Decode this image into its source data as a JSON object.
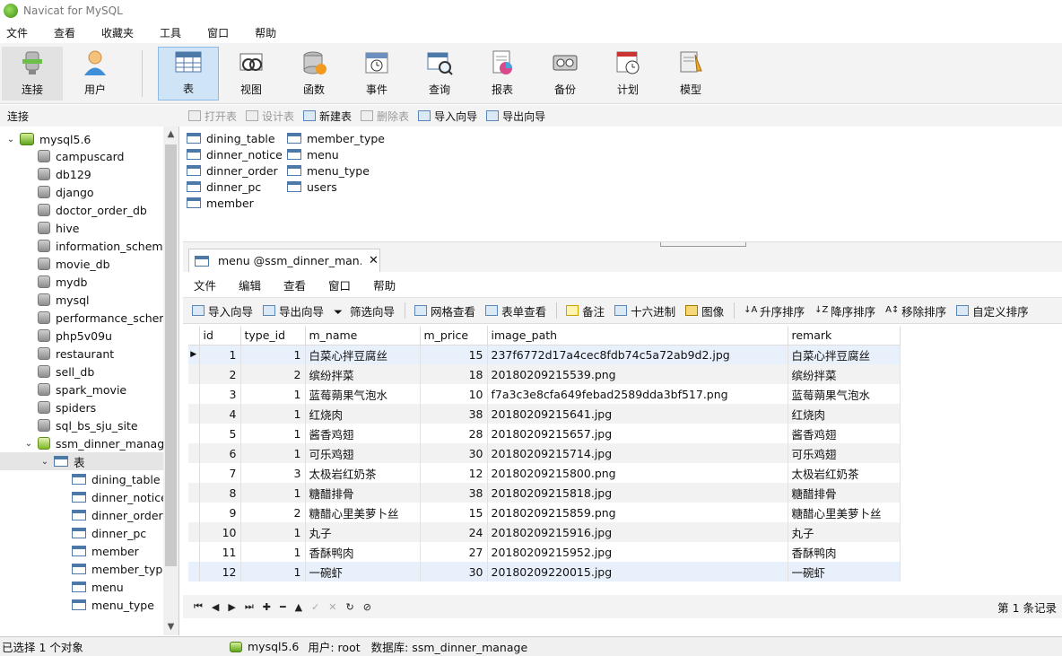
{
  "window": {
    "title": "Navicat for MySQL"
  },
  "menubar": [
    "文件",
    "查看",
    "收藏夹",
    "工具",
    "窗口",
    "帮助"
  ],
  "toolbar": [
    {
      "label": "连接",
      "icon": "connection-icon"
    },
    {
      "label": "用户",
      "icon": "user-icon"
    },
    {
      "label": "表",
      "icon": "table-icon",
      "active": true
    },
    {
      "label": "视图",
      "icon": "view-icon"
    },
    {
      "label": "函数",
      "icon": "function-icon"
    },
    {
      "label": "事件",
      "icon": "event-icon"
    },
    {
      "label": "查询",
      "icon": "query-icon"
    },
    {
      "label": "报表",
      "icon": "report-icon"
    },
    {
      "label": "备份",
      "icon": "backup-icon"
    },
    {
      "label": "计划",
      "icon": "schedule-icon"
    },
    {
      "label": "模型",
      "icon": "model-icon"
    }
  ],
  "conn_header": "连接",
  "object_toolbar": [
    {
      "label": "打开表",
      "enabled": false
    },
    {
      "label": "设计表",
      "enabled": false
    },
    {
      "label": "新建表",
      "enabled": true
    },
    {
      "label": "删除表",
      "enabled": false
    },
    {
      "label": "导入向导",
      "enabled": true
    },
    {
      "label": "导出向导",
      "enabled": true
    }
  ],
  "sidebar": {
    "connection": "mysql5.6",
    "databases": [
      "campuscard",
      "db129",
      "django",
      "doctor_order_db",
      "hive",
      "information_schema",
      "movie_db",
      "mydb",
      "mysql",
      "performance_schem",
      "php5v09u",
      "restaurant",
      "sell_db",
      "spark_movie",
      "spiders",
      "sql_bs_sju_site",
      "ssm_dinner_manage"
    ],
    "tables_node": "表",
    "tables": [
      "dining_table",
      "dinner_notice",
      "dinner_order",
      "dinner_pc",
      "member",
      "member_type",
      "menu",
      "menu_type"
    ]
  },
  "objects": {
    "col1": [
      "dining_table",
      "dinner_notice",
      "dinner_order",
      "dinner_pc",
      "member"
    ],
    "col2": [
      "member_type",
      "menu",
      "menu_type",
      "users"
    ]
  },
  "tab": {
    "label": "menu @ssm_dinner_man...",
    "close": "✕"
  },
  "sub_menubar": [
    "文件",
    "编辑",
    "查看",
    "窗口",
    "帮助"
  ],
  "grid_toolbar": [
    "导入向导",
    "导出向导",
    "筛选向导",
    "网格查看",
    "表单查看",
    "备注",
    "十六进制",
    "图像",
    "升序排序",
    "降序排序",
    "移除排序",
    "自定义排序"
  ],
  "grid": {
    "columns": [
      "id",
      "type_id",
      "m_name",
      "m_price",
      "image_path",
      "remark"
    ],
    "rows": [
      [
        "1",
        "1",
        "白菜心拌豆腐丝",
        "15",
        "237f6772d17a4cec8fdb74c5a72ab9d2.jpg",
        "白菜心拌豆腐丝"
      ],
      [
        "2",
        "2",
        "缤纷拌菜",
        "18",
        "20180209215539.png",
        "缤纷拌菜"
      ],
      [
        "3",
        "1",
        "蓝莓蒴果气泡水",
        "10",
        "f7a3c3e8cfa649febad2589dda3bf517.png",
        "蓝莓蒴果气泡水"
      ],
      [
        "4",
        "1",
        "红烧肉",
        "38",
        "20180209215641.jpg",
        "红烧肉"
      ],
      [
        "5",
        "1",
        "酱香鸡翅",
        "28",
        "20180209215657.jpg",
        "酱香鸡翅"
      ],
      [
        "6",
        "1",
        "可乐鸡翅",
        "30",
        "20180209215714.jpg",
        "可乐鸡翅"
      ],
      [
        "7",
        "3",
        "太极岩红奶茶",
        "12",
        "20180209215800.png",
        "太极岩红奶茶"
      ],
      [
        "8",
        "1",
        "糖醋排骨",
        "38",
        "20180209215818.jpg",
        "糖醋排骨"
      ],
      [
        "9",
        "2",
        "糖醋心里美萝卜丝",
        "15",
        "20180209215859.png",
        "糖醋心里美萝卜丝"
      ],
      [
        "10",
        "1",
        "丸子",
        "24",
        "20180209215916.jpg",
        "丸子"
      ],
      [
        "11",
        "1",
        "香酥鸭肉",
        "27",
        "20180209215952.jpg",
        "香酥鸭肉"
      ],
      [
        "12",
        "1",
        "一碗虾",
        "30",
        "20180209220015.jpg",
        "一碗虾"
      ]
    ]
  },
  "nav_bar": {
    "record_count": "第 1 条记录"
  },
  "statusbar": {
    "selection": "已选择 1 个对象",
    "connection": "mysql5.6",
    "user": "用户: root",
    "database": "数据库: ssm_dinner_manage"
  }
}
